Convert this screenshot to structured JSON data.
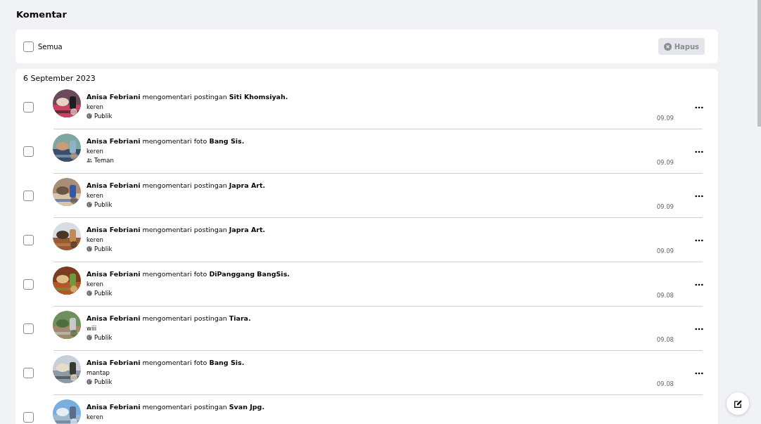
{
  "title": "Komentar",
  "toolbar": {
    "select_all": {
      "label": "Semua",
      "checked": false
    },
    "delete_button": {
      "label": "Hapus",
      "disabled": true
    }
  },
  "groups": [
    {
      "date": "6 September 2023",
      "items": [
        {
          "text": "**Anisa Febriani** mengomentari postingan **Siti Khomsiyah.**",
          "comment": "keren",
          "audience": {
            "kind": "public",
            "label": "Publik"
          },
          "time": "09.09",
          "checked": false
        },
        {
          "text": "**Anisa Febriani** mengomentari foto **Bang Sis.**",
          "comment": "keren",
          "audience": {
            "kind": "friends",
            "label": "Teman"
          },
          "time": "09.09",
          "checked": false
        },
        {
          "text": "**Anisa Febriani** mengomentari postingan **Japra Art.**",
          "comment": "keren",
          "audience": {
            "kind": "public",
            "label": "Publik"
          },
          "time": "09.09",
          "checked": false
        },
        {
          "text": "**Anisa Febriani** mengomentari postingan **Japra Art.**",
          "comment": "keren",
          "audience": {
            "kind": "public",
            "label": "Publik"
          },
          "time": "09.09",
          "checked": false
        },
        {
          "text": "**Anisa Febriani** mengomentari foto **DiPanggang BangSis.**",
          "comment": "keren",
          "audience": {
            "kind": "public",
            "label": "Publik"
          },
          "time": "09.08",
          "checked": false
        },
        {
          "text": "**Anisa Febriani** mengomentari postingan **Tiara.**",
          "comment": "wiii",
          "audience": {
            "kind": "public",
            "label": "Publik"
          },
          "time": "09.08",
          "checked": false
        },
        {
          "text": "**Anisa Febriani** mengomentari foto **Bang Sis.**",
          "comment": "mantap",
          "audience": {
            "kind": "public",
            "label": "Publik"
          },
          "time": "09.08",
          "checked": false
        },
        {
          "text": "**Anisa Febriani** mengomentari postingan **Svan Jpg.**",
          "comment": "keren",
          "checked": false
        }
      ]
    }
  ]
}
